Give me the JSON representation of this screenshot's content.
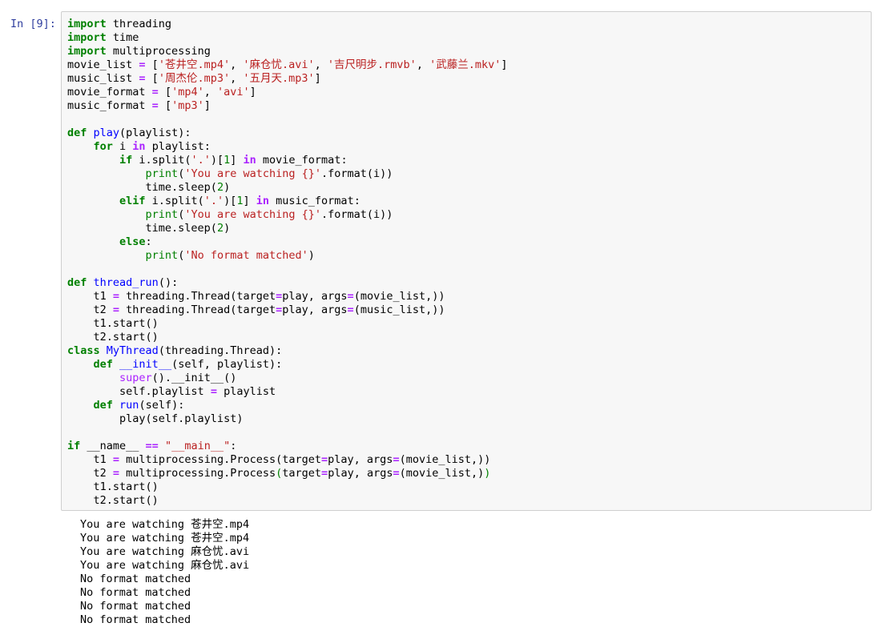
{
  "cell": {
    "prompt": "In [9]:"
  },
  "code_lines": [
    [
      {
        "t": "import",
        "c": "kw"
      },
      {
        "t": " threading"
      }
    ],
    [
      {
        "t": "import",
        "c": "kw"
      },
      {
        "t": " time"
      }
    ],
    [
      {
        "t": "import",
        "c": "kw"
      },
      {
        "t": " multiprocessing"
      }
    ],
    [
      {
        "t": "movie_list "
      },
      {
        "t": "=",
        "c": "op"
      },
      {
        "t": " ["
      },
      {
        "t": "'苍井空.mp4'",
        "c": "str"
      },
      {
        "t": ", "
      },
      {
        "t": "'麻仓忧.avi'",
        "c": "str"
      },
      {
        "t": ", "
      },
      {
        "t": "'吉尺明步.rmvb'",
        "c": "str"
      },
      {
        "t": ", "
      },
      {
        "t": "'武藤兰.mkv'",
        "c": "str"
      },
      {
        "t": "]"
      }
    ],
    [
      {
        "t": "music_list "
      },
      {
        "t": "=",
        "c": "op"
      },
      {
        "t": " ["
      },
      {
        "t": "'周杰伦.mp3'",
        "c": "str"
      },
      {
        "t": ", "
      },
      {
        "t": "'五月天.mp3'",
        "c": "str"
      },
      {
        "t": "]"
      }
    ],
    [
      {
        "t": "movie_format "
      },
      {
        "t": "=",
        "c": "op"
      },
      {
        "t": " ["
      },
      {
        "t": "'mp4'",
        "c": "str"
      },
      {
        "t": ", "
      },
      {
        "t": "'avi'",
        "c": "str"
      },
      {
        "t": "]"
      }
    ],
    [
      {
        "t": "music_format "
      },
      {
        "t": "=",
        "c": "op"
      },
      {
        "t": " ["
      },
      {
        "t": "'mp3'",
        "c": "str"
      },
      {
        "t": "]"
      }
    ],
    [],
    [
      {
        "t": "def",
        "c": "kw"
      },
      {
        "t": " "
      },
      {
        "t": "play",
        "c": "fn"
      },
      {
        "t": "(playlist):"
      }
    ],
    [
      {
        "t": "    "
      },
      {
        "t": "for",
        "c": "kw"
      },
      {
        "t": " i "
      },
      {
        "t": "in",
        "c": "op"
      },
      {
        "t": " playlist:"
      }
    ],
    [
      {
        "t": "        "
      },
      {
        "t": "if",
        "c": "kw"
      },
      {
        "t": " i.split("
      },
      {
        "t": "'.'",
        "c": "str"
      },
      {
        "t": ")["
      },
      {
        "t": "1",
        "c": "num"
      },
      {
        "t": "] "
      },
      {
        "t": "in",
        "c": "op"
      },
      {
        "t": " movie_format:"
      }
    ],
    [
      {
        "t": "            "
      },
      {
        "t": "print",
        "c": "bi"
      },
      {
        "t": "("
      },
      {
        "t": "'You are watching {}'",
        "c": "str"
      },
      {
        "t": ".format(i))"
      }
    ],
    [
      {
        "t": "            time.sleep("
      },
      {
        "t": "2",
        "c": "num"
      },
      {
        "t": ")"
      }
    ],
    [
      {
        "t": "        "
      },
      {
        "t": "elif",
        "c": "kw"
      },
      {
        "t": " i.split("
      },
      {
        "t": "'.'",
        "c": "str"
      },
      {
        "t": ")["
      },
      {
        "t": "1",
        "c": "num"
      },
      {
        "t": "] "
      },
      {
        "t": "in",
        "c": "op"
      },
      {
        "t": " music_format:"
      }
    ],
    [
      {
        "t": "            "
      },
      {
        "t": "print",
        "c": "bi"
      },
      {
        "t": "("
      },
      {
        "t": "'You are watching {}'",
        "c": "str"
      },
      {
        "t": ".format(i))"
      }
    ],
    [
      {
        "t": "            time.sleep("
      },
      {
        "t": "2",
        "c": "num"
      },
      {
        "t": ")"
      }
    ],
    [
      {
        "t": "        "
      },
      {
        "t": "else",
        "c": "kw"
      },
      {
        "t": ":"
      }
    ],
    [
      {
        "t": "            "
      },
      {
        "t": "print",
        "c": "bi"
      },
      {
        "t": "("
      },
      {
        "t": "'No format matched'",
        "c": "str"
      },
      {
        "t": ")"
      }
    ],
    [],
    [
      {
        "t": "def",
        "c": "kw"
      },
      {
        "t": " "
      },
      {
        "t": "thread_run",
        "c": "fn"
      },
      {
        "t": "():"
      }
    ],
    [
      {
        "t": "    t1 "
      },
      {
        "t": "=",
        "c": "op"
      },
      {
        "t": " threading.Thread(target"
      },
      {
        "t": "=",
        "c": "op"
      },
      {
        "t": "play, args"
      },
      {
        "t": "=",
        "c": "op"
      },
      {
        "t": "(movie_list,))"
      }
    ],
    [
      {
        "t": "    t2 "
      },
      {
        "t": "=",
        "c": "op"
      },
      {
        "t": " threading.Thread(target"
      },
      {
        "t": "=",
        "c": "op"
      },
      {
        "t": "play, args"
      },
      {
        "t": "=",
        "c": "op"
      },
      {
        "t": "(music_list,))"
      }
    ],
    [
      {
        "t": "    t1.start()"
      }
    ],
    [
      {
        "t": "    t2.start()"
      }
    ],
    [
      {
        "t": "class",
        "c": "kw"
      },
      {
        "t": " "
      },
      {
        "t": "MyThread",
        "c": "fn"
      },
      {
        "t": "(threading.Thread):"
      }
    ],
    [
      {
        "t": "    "
      },
      {
        "t": "def",
        "c": "kw"
      },
      {
        "t": " "
      },
      {
        "t": "__init__",
        "c": "fn"
      },
      {
        "t": "(self, playlist):"
      }
    ],
    [
      {
        "t": "        "
      },
      {
        "t": "super",
        "c": "bm"
      },
      {
        "t": "().__init__()"
      }
    ],
    [
      {
        "t": "        self.playlist "
      },
      {
        "t": "=",
        "c": "op"
      },
      {
        "t": " playlist"
      }
    ],
    [
      {
        "t": "    "
      },
      {
        "t": "def",
        "c": "kw"
      },
      {
        "t": " "
      },
      {
        "t": "run",
        "c": "fn"
      },
      {
        "t": "(self):"
      }
    ],
    [
      {
        "t": "        play(self.playlist)"
      }
    ],
    [],
    [
      {
        "t": "if",
        "c": "kw"
      },
      {
        "t": " __name__ "
      },
      {
        "t": "==",
        "c": "op"
      },
      {
        "t": " "
      },
      {
        "t": "\"__main__\"",
        "c": "str"
      },
      {
        "t": ":"
      }
    ],
    [
      {
        "t": "    t1 "
      },
      {
        "t": "=",
        "c": "op"
      },
      {
        "t": " multiprocessing.Process(target"
      },
      {
        "t": "=",
        "c": "op"
      },
      {
        "t": "play, args"
      },
      {
        "t": "=",
        "c": "op"
      },
      {
        "t": "(movie_list,))"
      }
    ],
    [
      {
        "t": "    t2 "
      },
      {
        "t": "=",
        "c": "op"
      },
      {
        "t": " multiprocessing.Process"
      },
      {
        "t": "(",
        "c": "num"
      },
      {
        "t": "target"
      },
      {
        "t": "=",
        "c": "op"
      },
      {
        "t": "play, args"
      },
      {
        "t": "=",
        "c": "op"
      },
      {
        "t": "(movie_list,)"
      },
      {
        "t": ")",
        "c": "num"
      }
    ],
    [
      {
        "t": "    t1.start()"
      }
    ],
    [
      {
        "t": "    t2.start()"
      }
    ]
  ],
  "output_lines": [
    "You are watching 苍井空.mp4",
    "You are watching 苍井空.mp4",
    "You are watching 麻仓忧.avi",
    "You are watching 麻仓忧.avi",
    "No format matched",
    "No format matched",
    "No format matched",
    "No format matched"
  ]
}
